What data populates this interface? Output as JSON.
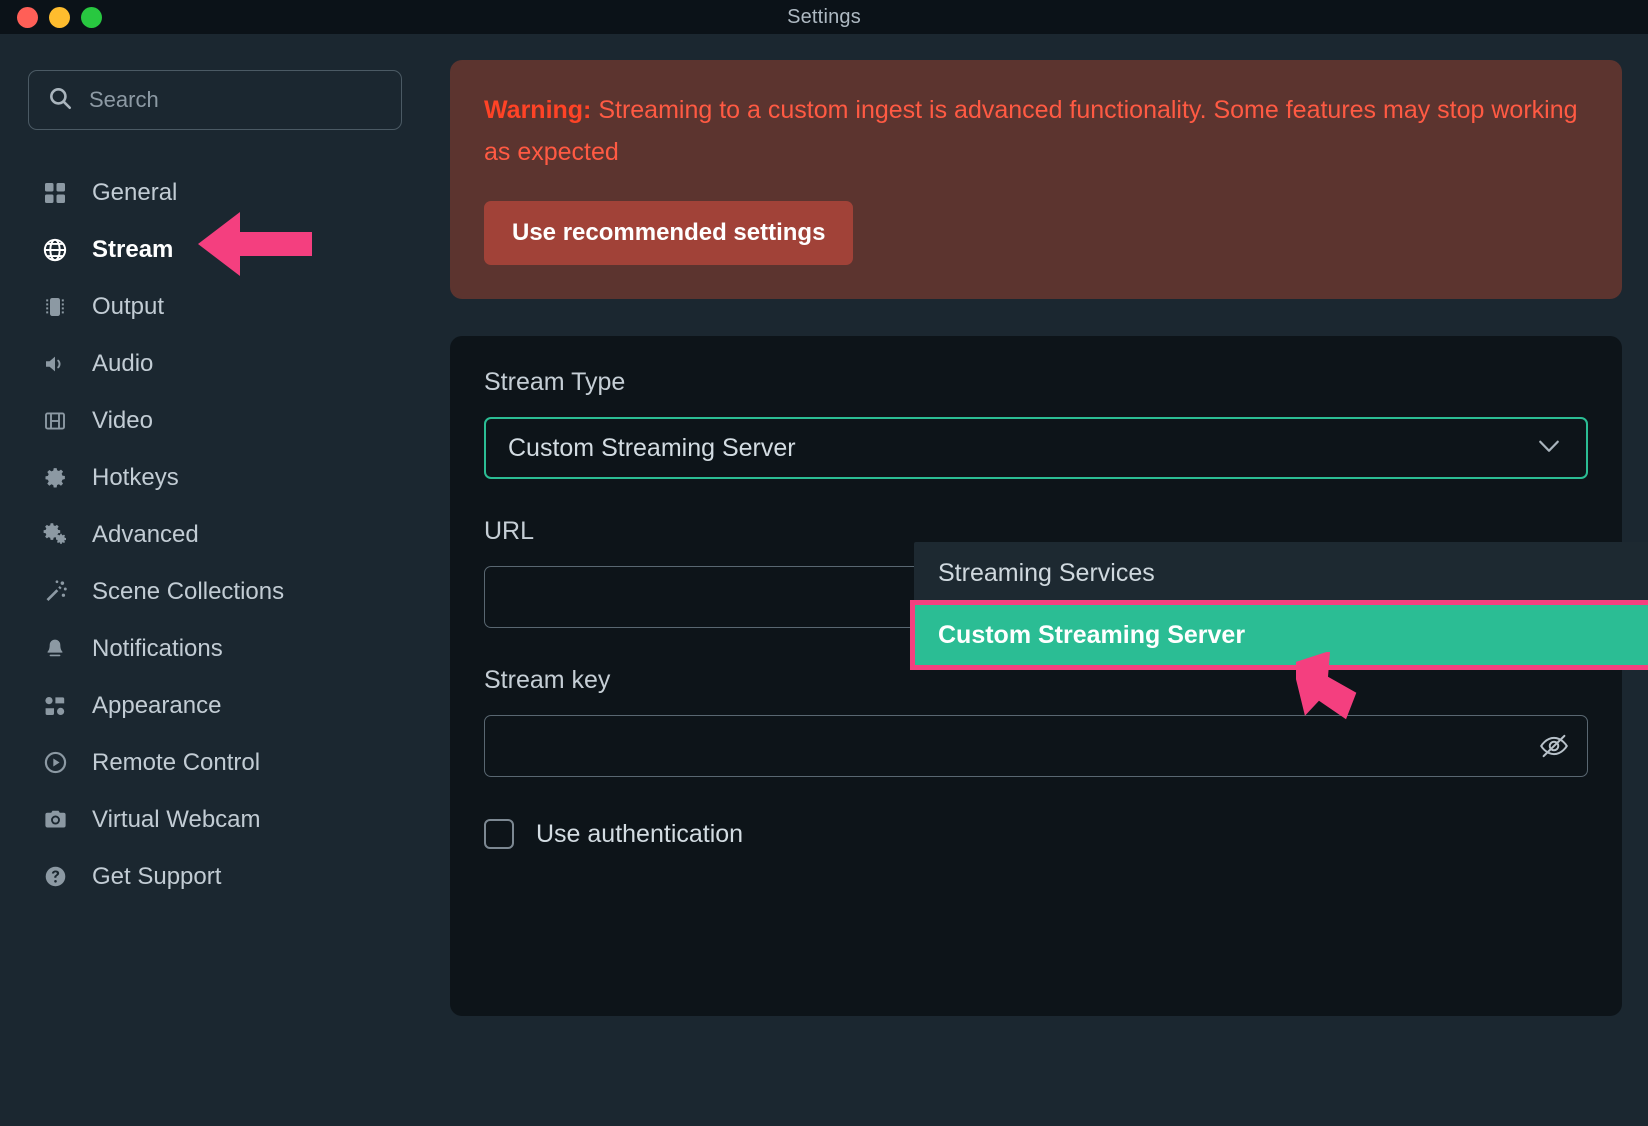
{
  "window": {
    "title": "Settings",
    "traffic_lights": [
      "close-red",
      "minimize-yellow",
      "maximize-green"
    ]
  },
  "sidebar": {
    "search": {
      "placeholder": "Search",
      "value": "",
      "icon": "search-icon"
    },
    "items": [
      {
        "label": "General",
        "icon": "grid-icon",
        "active": false
      },
      {
        "label": "Stream",
        "icon": "globe-icon",
        "active": true
      },
      {
        "label": "Output",
        "icon": "chip-icon",
        "active": false
      },
      {
        "label": "Audio",
        "icon": "speaker-icon",
        "active": false
      },
      {
        "label": "Video",
        "icon": "film-icon",
        "active": false
      },
      {
        "label": "Hotkeys",
        "icon": "gear-icon",
        "active": false
      },
      {
        "label": "Advanced",
        "icon": "gears-icon",
        "active": false
      },
      {
        "label": "Scene Collections",
        "icon": "wand-icon",
        "active": false
      },
      {
        "label": "Notifications",
        "icon": "bell-icon",
        "active": false
      },
      {
        "label": "Appearance",
        "icon": "shapes-icon",
        "active": false
      },
      {
        "label": "Remote Control",
        "icon": "play-circle-icon",
        "active": false
      },
      {
        "label": "Virtual Webcam",
        "icon": "camera-icon",
        "active": false
      },
      {
        "label": "Get Support",
        "icon": "help-circle-icon",
        "active": false
      }
    ]
  },
  "warning": {
    "prefix": "Warning:",
    "message": " Streaming to a custom ingest is advanced functionality. Some features may stop working as expected",
    "button_label": "Use recommended settings",
    "bg_color": "#5c342f",
    "text_color": "#ff5a43",
    "button_color": "#a14238"
  },
  "form": {
    "stream_type": {
      "label": "Stream Type",
      "value": "Custom Streaming Server",
      "chevron_icon": "chevron-down-icon",
      "focus_color": "#2bbd94"
    },
    "url": {
      "label": "URL",
      "value": "",
      "placeholder": ""
    },
    "stream_key": {
      "label": "Stream key",
      "value": "",
      "placeholder": "",
      "reveal_icon": "eye-off-icon"
    },
    "use_authentication": {
      "label": "Use authentication",
      "checked": false
    }
  },
  "dropdown": {
    "open": true,
    "options": [
      {
        "label": "Streaming Services",
        "selected": false
      },
      {
        "label": "Custom Streaming Server",
        "selected": true
      }
    ],
    "highlight_color": "#2bbd94",
    "annotation_color": "#f43f7f"
  },
  "annotations": {
    "arrow_color": "#f43f7f",
    "arrows": [
      {
        "name": "arrow-pointing-stream-nav-item",
        "direction": "left"
      },
      {
        "name": "arrow-pointing-custom-streaming-server-option",
        "direction": "up-left"
      }
    ]
  }
}
